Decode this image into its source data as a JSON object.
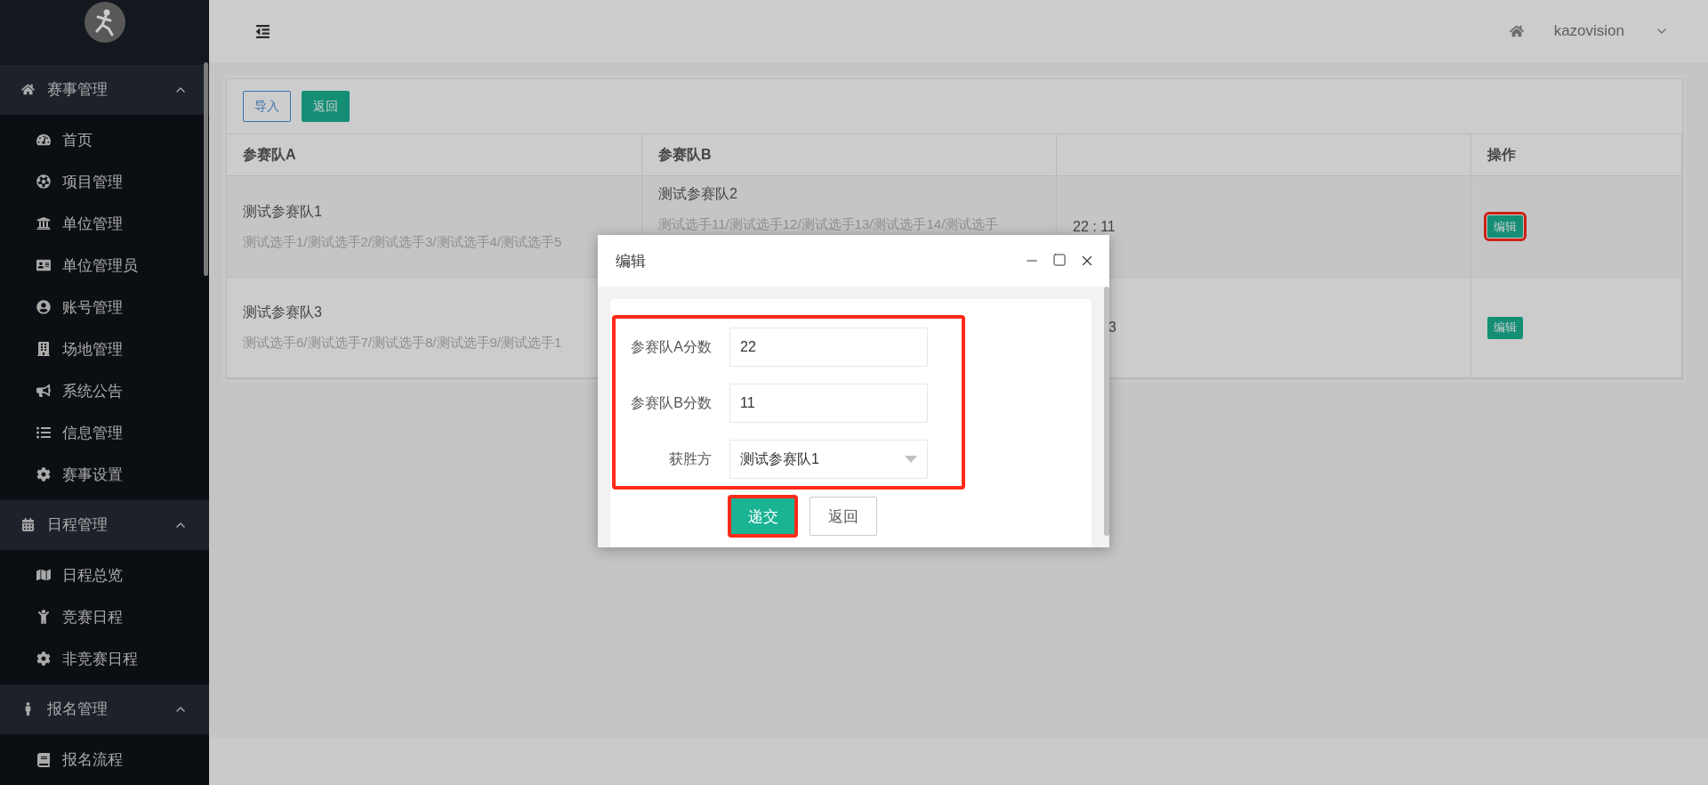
{
  "sidebar": {
    "groups": [
      {
        "title": "赛事管理",
        "expanded": true,
        "items": [
          {
            "label": "首页"
          },
          {
            "label": "项目管理"
          },
          {
            "label": "单位管理"
          },
          {
            "label": "单位管理员"
          },
          {
            "label": "账号管理"
          },
          {
            "label": "场地管理"
          },
          {
            "label": "系统公告"
          },
          {
            "label": "信息管理"
          },
          {
            "label": "赛事设置"
          }
        ]
      },
      {
        "title": "日程管理",
        "expanded": true,
        "items": [
          {
            "label": "日程总览"
          },
          {
            "label": "竞赛日程"
          },
          {
            "label": "非竞赛日程"
          }
        ]
      },
      {
        "title": "报名管理",
        "expanded": true,
        "items": [
          {
            "label": "报名流程"
          }
        ]
      }
    ]
  },
  "header": {
    "user": "kazovision"
  },
  "toolbar": {
    "buttons": [
      {
        "label": "导入",
        "kind": "outline"
      },
      {
        "label": "返回",
        "kind": "primary"
      }
    ]
  },
  "table": {
    "columns": [
      "参赛队A",
      "参赛队B",
      null,
      "操作"
    ],
    "rows": [
      {
        "team_a": {
          "name": "测试参赛队1",
          "players": "测试选手1/测试选手2/测试选手3/测试选手4/测试选手5"
        },
        "team_b": {
          "name": "测试参赛队2",
          "players": "测试选手11/测试选手12/测试选手13/测试选手14/测试选手"
        },
        "score": "22 : 11",
        "score_clipped": false,
        "action": "编辑",
        "highlighted": true
      },
      {
        "team_a": {
          "name": "测试参赛队3",
          "players": "测试选手6/测试选手7/测试选手8/测试选手9/测试选手1"
        },
        "score": "3",
        "score_clipped": true,
        "action": "编辑",
        "highlighted": false
      }
    ]
  },
  "dialog": {
    "title": "编辑",
    "form_highlighted": true,
    "fields": [
      {
        "label": "参赛队A分数",
        "value": "22",
        "kind": "input"
      },
      {
        "label": "参赛队B分数",
        "value": "11",
        "kind": "input"
      },
      {
        "label": "获胜方",
        "value": "测试参赛队1",
        "kind": "select"
      }
    ],
    "buttons": [
      {
        "label": "递交",
        "kind": "primary",
        "highlighted": true
      },
      {
        "label": "返回",
        "kind": "default",
        "highlighted": false
      }
    ]
  }
}
